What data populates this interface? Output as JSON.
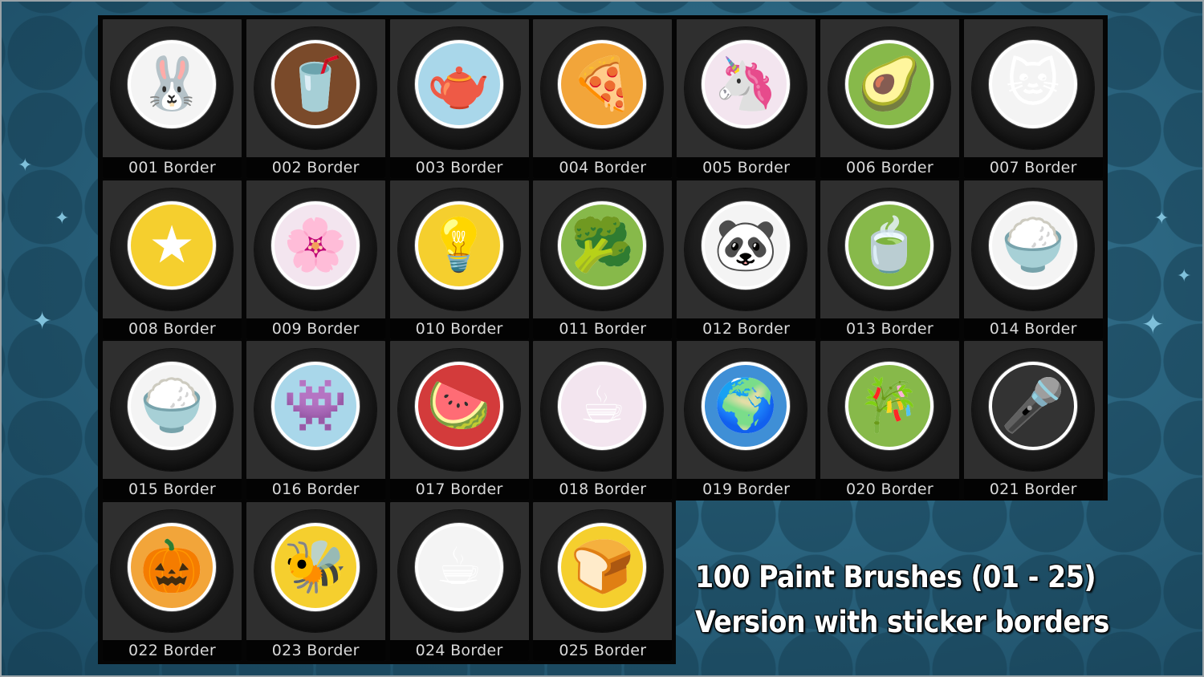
{
  "caption": {
    "line1": "100 Paint Brushes (01 - 25)",
    "line2": "Version with sticker borders"
  },
  "brushes": [
    {
      "label": "001 Border",
      "icon": "bunny-icon",
      "glyph": "🐰",
      "color": "white"
    },
    {
      "label": "002 Border",
      "icon": "frappe-cup-icon",
      "glyph": "🥤",
      "color": "brown"
    },
    {
      "label": "003 Border",
      "icon": "teapot-icon",
      "glyph": "🫖",
      "color": "blue"
    },
    {
      "label": "004 Border",
      "icon": "pizza-slice-icon",
      "glyph": "🍕",
      "color": "orange"
    },
    {
      "label": "005 Border",
      "icon": "unicorn-icon",
      "glyph": "🦄",
      "color": "pink"
    },
    {
      "label": "006 Border",
      "icon": "avocado-icon",
      "glyph": "🥑",
      "color": "green"
    },
    {
      "label": "007 Border",
      "icon": "cat-in-box-icon",
      "glyph": "🐱",
      "color": "white"
    },
    {
      "label": "008 Border",
      "icon": "star-icon",
      "glyph": "★",
      "color": "yellow"
    },
    {
      "label": "009 Border",
      "icon": "potted-flower-icon",
      "glyph": "🌸",
      "color": "pink"
    },
    {
      "label": "010 Border",
      "icon": "light-bulb-icon",
      "glyph": "💡",
      "color": "yellow"
    },
    {
      "label": "011 Border",
      "icon": "broccoli-icon",
      "glyph": "🥦",
      "color": "green"
    },
    {
      "label": "012 Border",
      "icon": "panda-icon",
      "glyph": "🐼",
      "color": "white"
    },
    {
      "label": "013 Border",
      "icon": "matcha-bowl-icon",
      "glyph": "🍵",
      "color": "green"
    },
    {
      "label": "014 Border",
      "icon": "rice-cooker-icon",
      "glyph": "🍚",
      "color": "white"
    },
    {
      "label": "015 Border",
      "icon": "rice-bowl-icon",
      "glyph": "🍚",
      "color": "white"
    },
    {
      "label": "016 Border",
      "icon": "monster-icon",
      "glyph": "👾",
      "color": "blue"
    },
    {
      "label": "017 Border",
      "icon": "watermelon-icon",
      "glyph": "🍉",
      "color": "red"
    },
    {
      "label": "018 Border",
      "icon": "cat-in-cup-icon",
      "glyph": "☕",
      "color": "pink"
    },
    {
      "label": "019 Border",
      "icon": "earth-icon",
      "glyph": "🌍",
      "color": "earth"
    },
    {
      "label": "020 Border",
      "icon": "bamboo-icon",
      "glyph": "🎋",
      "color": "green"
    },
    {
      "label": "021 Border",
      "icon": "microphone-icon",
      "glyph": "🎤",
      "color": "dark"
    },
    {
      "label": "022 Border",
      "icon": "pumpkin-icon",
      "glyph": "🎃",
      "color": "orange"
    },
    {
      "label": "023 Border",
      "icon": "bee-icon",
      "glyph": "🐝",
      "color": "yellow"
    },
    {
      "label": "024 Border",
      "icon": "coffee-mug-icon",
      "glyph": "☕",
      "color": "white"
    },
    {
      "label": "025 Border",
      "icon": "toaster-icon",
      "glyph": "🍞",
      "color": "yellow"
    }
  ]
}
